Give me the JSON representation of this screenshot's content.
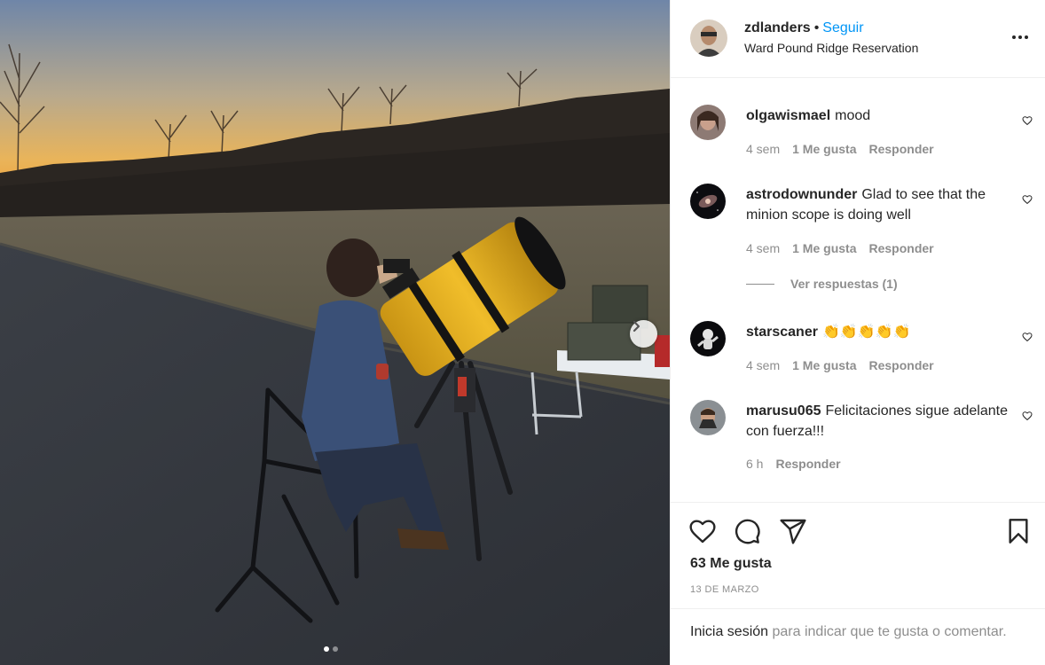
{
  "post": {
    "username": "zdlanders",
    "dot": "•",
    "follow_label": "Seguir",
    "location": "Ward Pound Ridge Reservation",
    "carousel": {
      "count": 2,
      "active_index": 0
    }
  },
  "comments": [
    {
      "username": "olgawismael",
      "text": "mood",
      "time": "4 sem",
      "likes": "1 Me gusta",
      "reply": "Responder"
    },
    {
      "username": "astrodownunder",
      "text": "Glad to see that the minion scope is doing well",
      "time": "4 sem",
      "likes": "1 Me gusta",
      "reply": "Responder",
      "view_replies": "Ver respuestas (1)"
    },
    {
      "username": "starscaner",
      "text": "👏👏👏👏👏",
      "time": "4 sem",
      "likes": "1 Me gusta",
      "reply": "Responder"
    },
    {
      "username": "marusu065",
      "text": "Felicitaciones sigue adelante con fuerza!!!",
      "time": "6 h",
      "reply": "Responder"
    }
  ],
  "footer": {
    "likes_count": "63 Me gusta",
    "date": "13 DE MARZO",
    "login_link": "Inicia sesión",
    "login_text": " para indicar que te gusta o comentar."
  },
  "colors": {
    "accent": "#0095f6",
    "text": "#262626",
    "muted": "#8e8e8e",
    "border": "#efefef"
  },
  "icons": [
    "heart-icon",
    "comment-icon",
    "share-icon",
    "bookmark-icon",
    "more-icon",
    "chevron-right-icon"
  ]
}
